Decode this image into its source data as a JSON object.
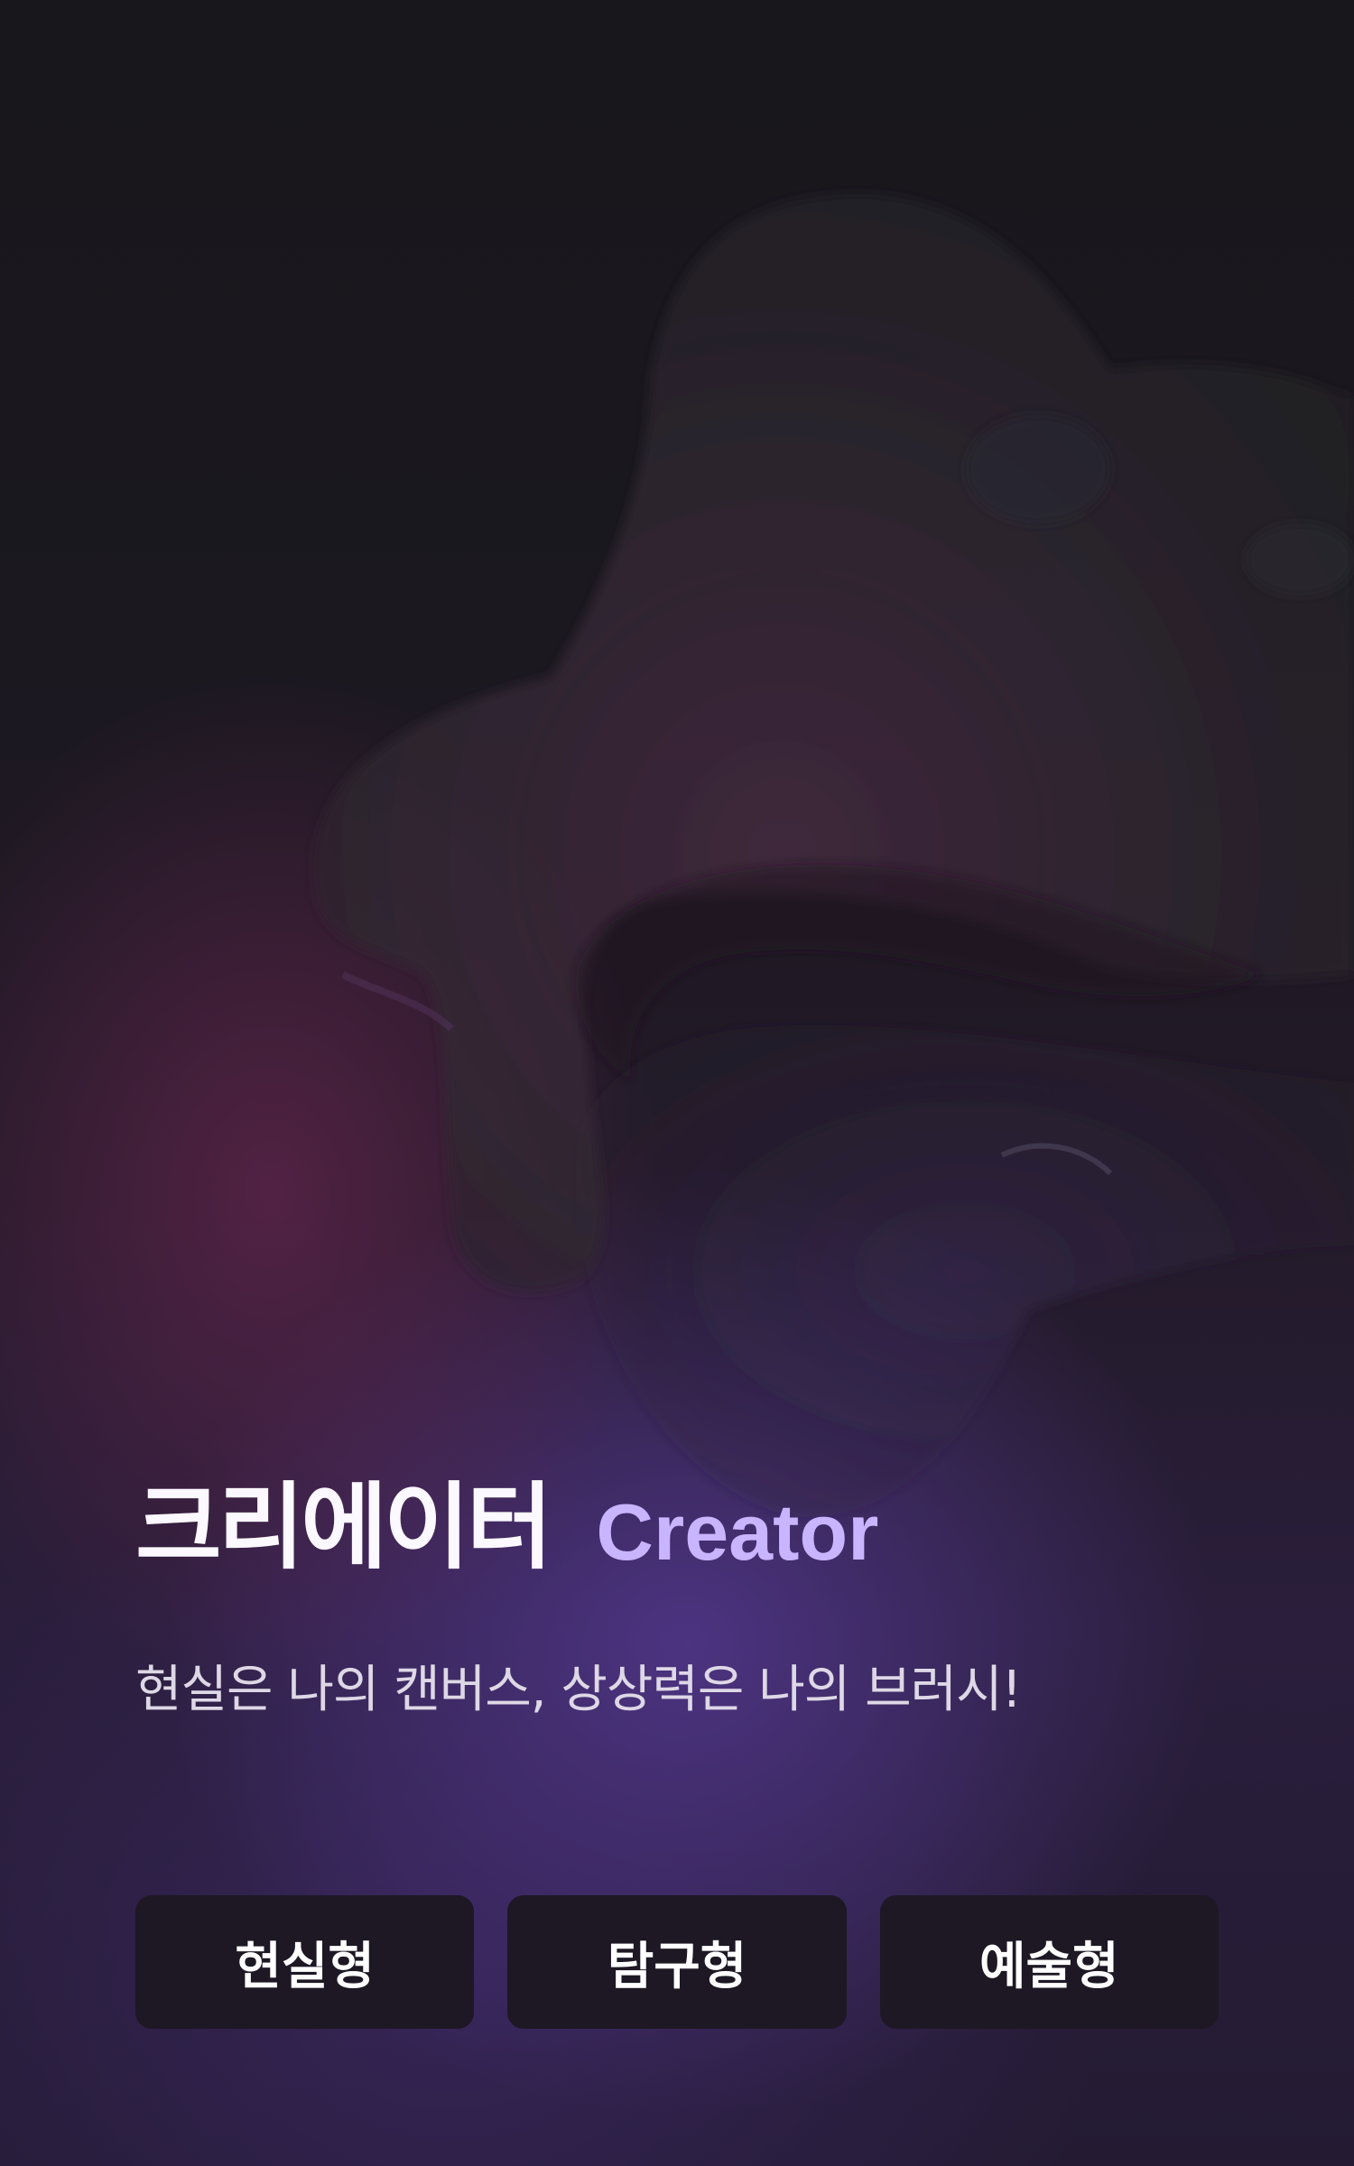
{
  "hero": {
    "title_ko": "크리에이터",
    "title_en": "Creator",
    "subtitle": "현실은 나의 캔버스, 상상력은 나의 브러시!"
  },
  "type_buttons": [
    {
      "label": "현실형"
    },
    {
      "label": "탐구형"
    },
    {
      "label": "예술형"
    }
  ],
  "colors": {
    "title": "#fbf8ff",
    "title_accent": "#c9b4ff",
    "subtitle": "#ded8e6",
    "button_bg": "#1d1824",
    "button_text": "#ffffff"
  }
}
